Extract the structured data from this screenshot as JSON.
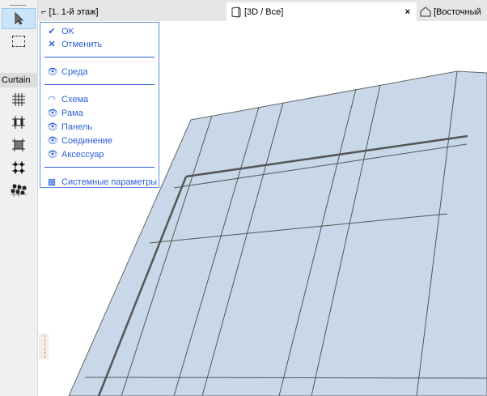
{
  "tabs": [
    {
      "label": "[1. 1-й этаж]"
    },
    {
      "label": "[3D / Все]",
      "active": true
    },
    {
      "label": "[Восточный"
    }
  ],
  "toolbox": {
    "section_label": "Curtain"
  },
  "menu": {
    "ok": "OK",
    "cancel": "Отменить",
    "environment": "Среда",
    "items": [
      {
        "label": "Схема",
        "icon": "eye-closed-icon"
      },
      {
        "label": "Рама",
        "icon": "eye-icon"
      },
      {
        "label": "Панель",
        "icon": "eye-icon"
      },
      {
        "label": "Соединение",
        "icon": "eye-icon"
      },
      {
        "label": "Аксессуар",
        "icon": "eye-icon"
      }
    ],
    "system": "Системные параметры"
  },
  "colors": {
    "accent": "#2a5fd8",
    "panel": "#c8d8e8"
  }
}
